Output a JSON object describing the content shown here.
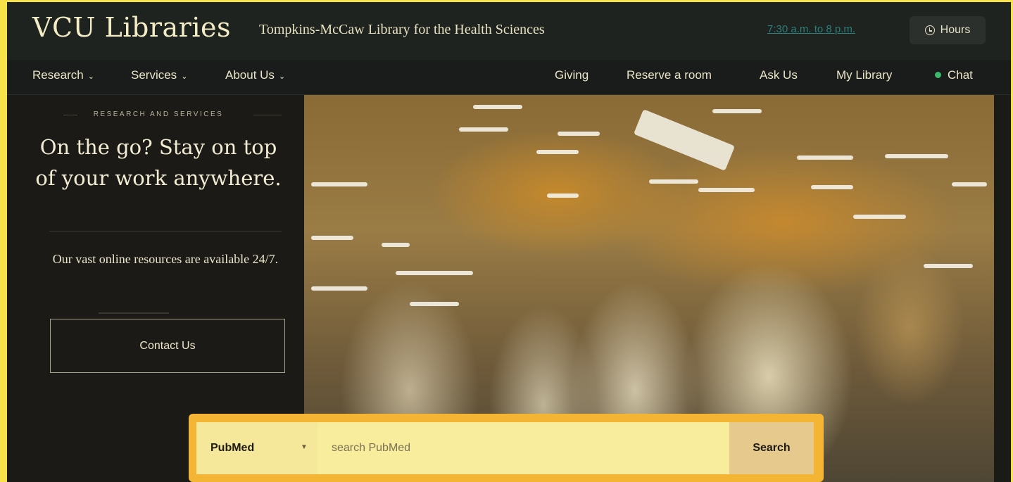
{
  "header": {
    "brand": "VCU Libraries",
    "subbrand": "Tompkins-McCaw Library for the Health Sciences",
    "hours_today": "7:30 a.m. to 8 p.m.",
    "hours_button": "Hours",
    "hours_icon": "clock-icon"
  },
  "nav": {
    "left": [
      {
        "label": "Research",
        "icon": "chevron-down-icon"
      },
      {
        "label": "Services",
        "icon": "chevron-down-icon"
      },
      {
        "label": "About Us",
        "icon": "chevron-down-icon"
      }
    ],
    "right": [
      {
        "label": "Giving"
      },
      {
        "label": "Reserve a room"
      },
      {
        "label": "Ask Us"
      },
      {
        "label": "My Library"
      },
      {
        "label": "Chat",
        "status_color": "#3cb86b"
      }
    ]
  },
  "feature": {
    "eyebrow": "RESEARCH AND SERVICES",
    "headline": "On the go? Stay on top of your work anywhere.",
    "body": "Our vast online resources are available 24/7.",
    "cta": "Contact Us"
  },
  "search": {
    "source_selected": "PubMed",
    "placeholder": "search PubMed",
    "button": "Search"
  },
  "colors": {
    "accent": "#f4b534",
    "chat_online": "#3cb86b",
    "hours_link": "#2f7d7a"
  }
}
